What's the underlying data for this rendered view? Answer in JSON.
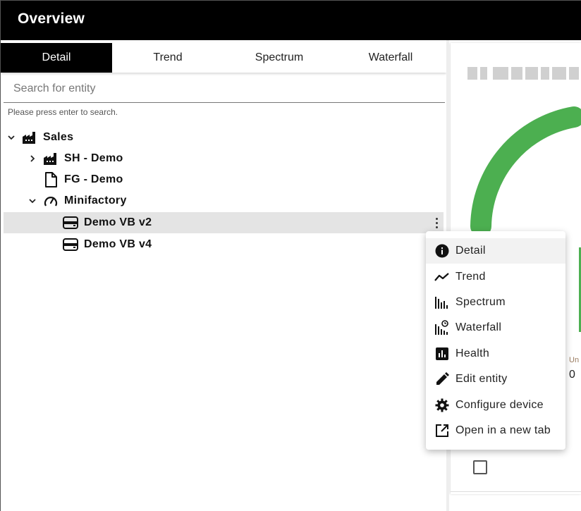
{
  "header": {
    "title": "Overview"
  },
  "tabs": [
    {
      "label": "Detail",
      "active": true
    },
    {
      "label": "Trend",
      "active": false
    },
    {
      "label": "Spectrum",
      "active": false
    },
    {
      "label": "Waterfall",
      "active": false
    }
  ],
  "search": {
    "placeholder": "Search for entity",
    "hint": "Please press enter to search."
  },
  "tree": [
    {
      "label": "Sales",
      "icon": "factory-icon",
      "expander": "expanded"
    },
    {
      "label": "SH - Demo",
      "icon": "factory-icon",
      "expander": "collapsed"
    },
    {
      "label": "FG - Demo",
      "icon": "document-icon",
      "expander": "none"
    },
    {
      "label": "Minifactory",
      "icon": "gauge-icon",
      "expander": "expanded"
    },
    {
      "label": "Demo VB v2",
      "icon": "device-icon",
      "expander": "none",
      "selected": true
    },
    {
      "label": "Demo VB v4",
      "icon": "device-icon",
      "expander": "none"
    }
  ],
  "context_menu": {
    "items": [
      {
        "label": "Detail",
        "icon": "info-icon"
      },
      {
        "label": "Trend",
        "icon": "trend-icon"
      },
      {
        "label": "Spectrum",
        "icon": "spectrum-icon"
      },
      {
        "label": "Waterfall",
        "icon": "waterfall-icon"
      },
      {
        "label": "Health",
        "icon": "health-icon"
      },
      {
        "label": "Edit entity",
        "icon": "edit-icon"
      },
      {
        "label": "Configure device",
        "icon": "gear-icon"
      },
      {
        "label": "Open in a new tab",
        "icon": "open-new-tab-icon"
      }
    ]
  },
  "right_panel": {
    "unit_label": "Un",
    "value": "0",
    "gauge_color": "#4caf50"
  },
  "colors": {
    "header_bg": "#000000",
    "selected_row": "#e4e4e4"
  }
}
